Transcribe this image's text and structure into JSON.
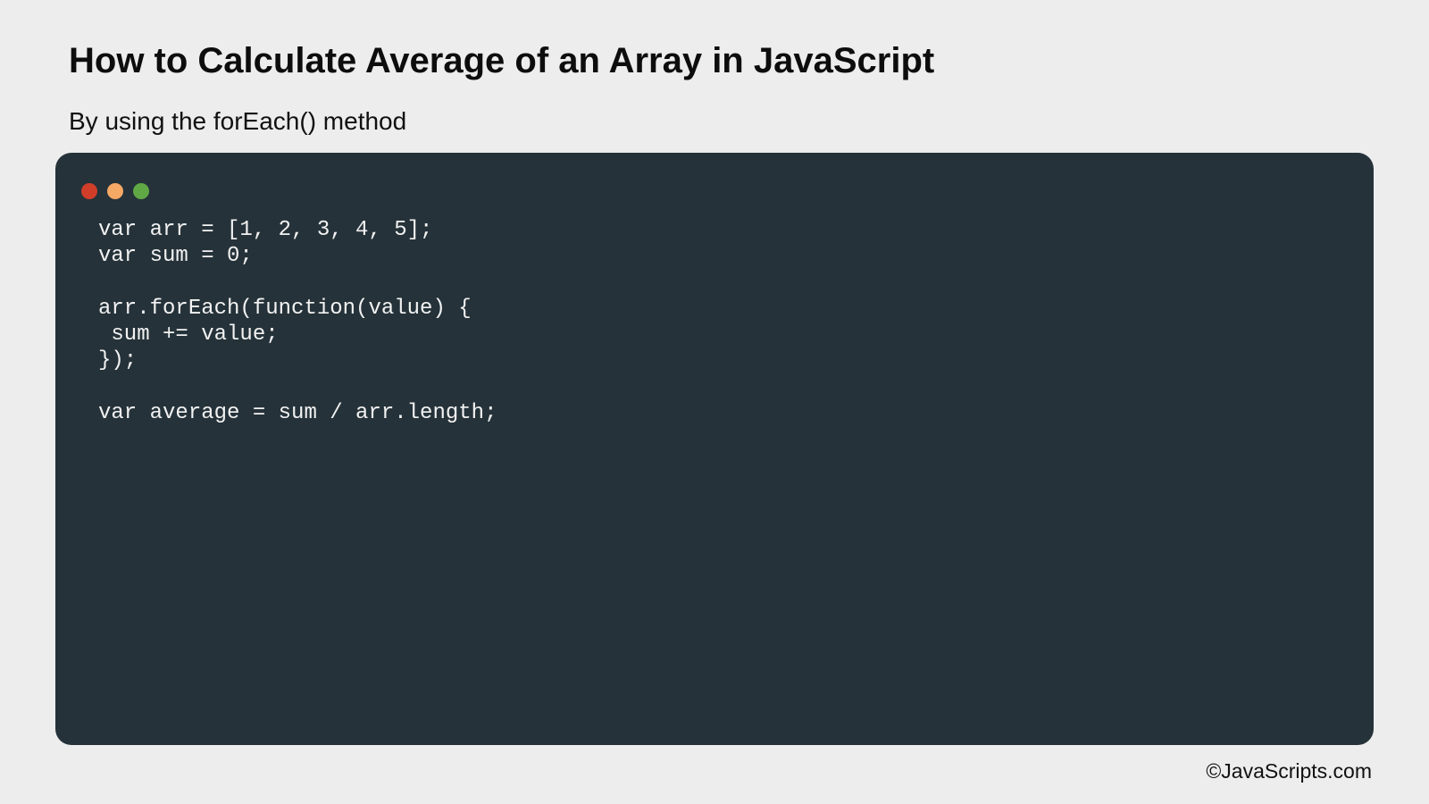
{
  "header": {
    "title": "How to Calculate Average of an Array in JavaScript",
    "subtitle": "By using the forEach() method"
  },
  "code_window": {
    "dots": [
      {
        "name": "red-dot",
        "color": "#d03e2a"
      },
      {
        "name": "orange-dot",
        "color": "#f6a865"
      },
      {
        "name": "green-dot",
        "color": "#60a846"
      }
    ],
    "lines": [
      "var arr = [1, 2, 3, 4, 5];",
      "var sum = 0;",
      "",
      "arr.forEach(function(value) {",
      " sum += value;",
      "});",
      "",
      "var average = sum / arr.length;"
    ]
  },
  "footer": {
    "credit": "©JavaScripts.com"
  }
}
